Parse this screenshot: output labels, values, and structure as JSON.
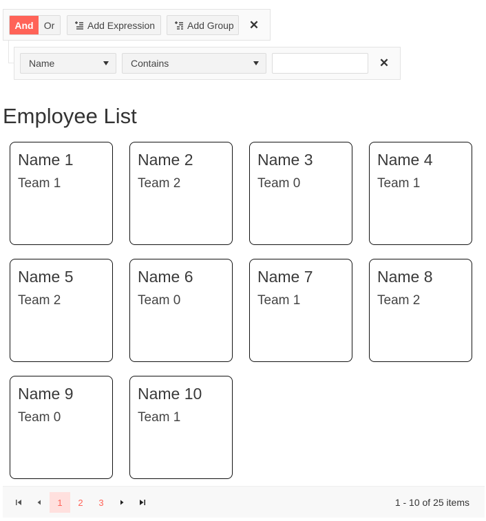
{
  "filter": {
    "logic": {
      "and_label": "And",
      "or_label": "Or",
      "selected": "And"
    },
    "add_expression_label": "Add Expression",
    "add_group_label": "Add Group",
    "close_symbol": "✕",
    "expression": {
      "field": "Name",
      "operator": "Contains",
      "value": "",
      "close_symbol": "✕"
    }
  },
  "list": {
    "title": "Employee List",
    "items": [
      {
        "name": "Name 1",
        "team": "Team 1"
      },
      {
        "name": "Name 2",
        "team": "Team 2"
      },
      {
        "name": "Name 3",
        "team": "Team 0"
      },
      {
        "name": "Name 4",
        "team": "Team 1"
      },
      {
        "name": "Name 5",
        "team": "Team 2"
      },
      {
        "name": "Name 6",
        "team": "Team 0"
      },
      {
        "name": "Name 7",
        "team": "Team 1"
      },
      {
        "name": "Name 8",
        "team": "Team 2"
      },
      {
        "name": "Name 9",
        "team": "Team 0"
      },
      {
        "name": "Name 10",
        "team": "Team 1"
      }
    ]
  },
  "pager": {
    "first_icon": "⏮",
    "prev_icon": "◂",
    "next_icon": "▸",
    "last_icon": "⏭",
    "pages": [
      "1",
      "2",
      "3"
    ],
    "current_page": "1",
    "info": "1 - 10 of 25 items"
  },
  "colors": {
    "accent": "#ff6358",
    "active_page_bg": "#ffe0de",
    "card_border": "#111111"
  }
}
